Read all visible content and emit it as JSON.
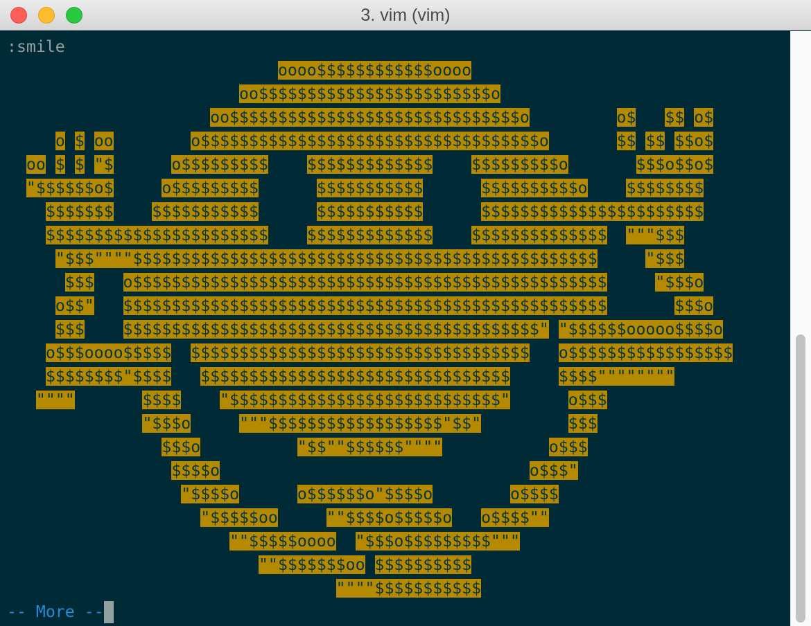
{
  "window": {
    "title": "3. vim (vim)"
  },
  "terminal": {
    "command": ":smile",
    "more_prompt": "-- More --",
    "colors": {
      "background": "#002b36",
      "highlight_bg": "#b58900",
      "highlight_fg": "#073642",
      "text": "#93a1a1",
      "prompt": "#268bd2"
    },
    "art": [
      "                            oooo$$$$$$$$$$$$oooo",
      "                        oo$$$$$$$$$$$$$$$$$$$$$$$$o",
      "                     oo$$$$$$$$$$$$$$$$$$$$$$$$$$$$$$o         o$   $$ o$",
      "     o $ oo        o$$$$$$$$$$$$$$$$$$$$$$$$$$$$$$$$$$$o       $$ $$ $$o$",
      "  oo $ $ \"$      o$$$$$$$$$    $$$$$$$$$$$$$    $$$$$$$$$o       $$$o$$o$",
      "  \"$$$$$$o$     o$$$$$$$$$      $$$$$$$$$$$      $$$$$$$$$$o    $$$$$$$$",
      "    $$$$$$$    $$$$$$$$$$$      $$$$$$$$$$$      $$$$$$$$$$$$$$$$$$$$$$$",
      "    $$$$$$$$$$$$$$$$$$$$$$$    $$$$$$$$$$$$$    $$$$$$$$$$$$$$  \"\"\"$$$",
      "     \"$$$\"\"\"\"$$$$$$$$$$$$$$$$$$$$$$$$$$$$$$$$$$$$$$$$$$$$$$$$     \"$$$",
      "      $$$   o$$$$$$$$$$$$$$$$$$$$$$$$$$$$$$$$$$$$$$$$$$$$$$$$$     \"$$$o",
      "     o$$\"   $$$$$$$$$$$$$$$$$$$$$$$$$$$$$$$$$$$$$$$$$$$$$$$$$$       $$$o",
      "     $$$    $$$$$$$$$$$$$$$$$$$$$$$$$$$$$$$$$$$$$$$$$$$\" \"$$$$$$ooooo$$$$o",
      "    o$$$oooo$$$$$  $$$$$$$$$$$$$$$$$$$$$$$$$$$$$$$$$$$   o$$$$$$$$$$$$$$$$$",
      "    $$$$$$$$\"$$$$   $$$$$$$$$$$$$$$$$$$$$$$$$$$$$$$$     $$$$\"\"\"\"\"\"\"\"",
      "   \"\"\"\"       $$$$    \"$$$$$$$$$$$$$$$$$$$$$$$$$$$$\"      o$$$",
      "              \"$$$o     \"\"\"$$$$$$$$$$$$$$$$$$\"$$\"         $$$",
      "                $$$o          \"$$\"\"$$$$$$\"\"\"\"           o$$$",
      "                 $$$$o                                o$$$\"",
      "                  \"$$$$o      o$$$$$$o\"$$$$o        o$$$$",
      "                    \"$$$$$oo     \"\"$$$$o$$$$$o   o$$$$\"\"",
      "                       \"\"$$$$$oooo  \"$$$o$$$$$$$$$\"\"\"",
      "                          \"\"$$$$$$$oo $$$$$$$$$$",
      "                                  \"\"\"\"$$$$$$$$$$$"
    ]
  },
  "scrollbar": {
    "position": 0.82
  }
}
